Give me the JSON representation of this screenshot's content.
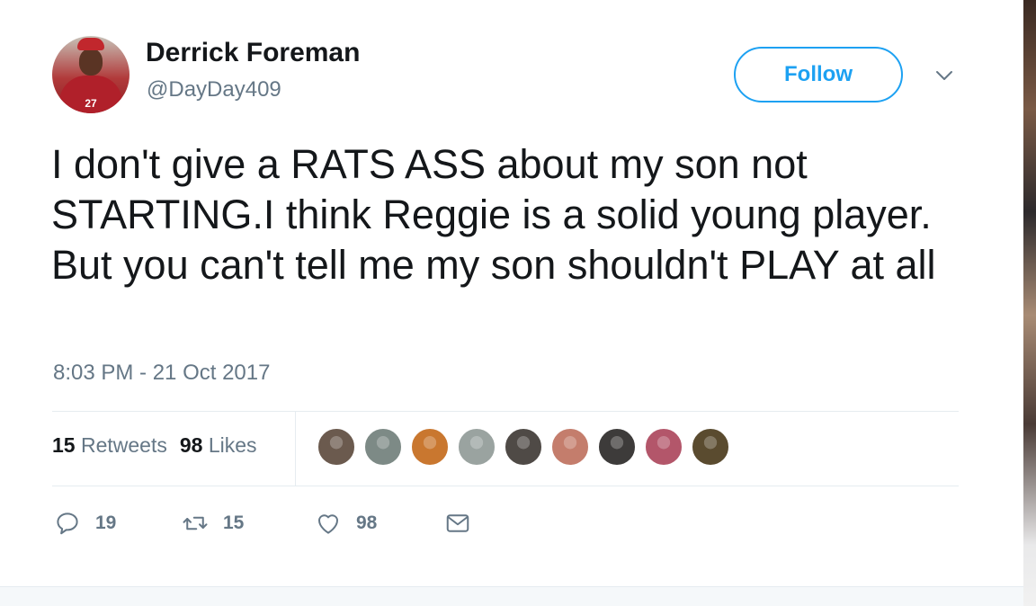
{
  "author": {
    "name": "Derrick Foreman",
    "handle": "@DayDay409",
    "avatar_jersey_number": "27"
  },
  "follow_button": {
    "label": "Follow"
  },
  "tweet": {
    "text": "I don't give a RATS ASS about my son not STARTING.I think Reggie is a solid young player. But you can't tell me my son shouldn't PLAY at all",
    "timestamp": "8:03 PM - 21 Oct 2017"
  },
  "stats": {
    "retweets_count": "15",
    "retweets_label": "Retweets",
    "likes_count": "98",
    "likes_label": "Likes"
  },
  "likers": [
    {
      "name": "liker-1",
      "color": "#6b5a4e"
    },
    {
      "name": "liker-2",
      "color": "#7d8a86"
    },
    {
      "name": "liker-3",
      "color": "#c9772f"
    },
    {
      "name": "liker-4",
      "color": "#9aa3a0"
    },
    {
      "name": "liker-5",
      "color": "#4f4a46"
    },
    {
      "name": "liker-6",
      "color": "#c47d6c"
    },
    {
      "name": "liker-7",
      "color": "#3d3b3a"
    },
    {
      "name": "liker-8",
      "color": "#b3566a"
    },
    {
      "name": "liker-9",
      "color": "#5a4b2f"
    }
  ],
  "actions": {
    "reply_count": "19",
    "retweet_count": "15",
    "like_count": "98"
  },
  "colors": {
    "accent": "#1da1f2",
    "secondary_text": "#657786",
    "primary_text": "#14171a",
    "divider": "#e6ecf0"
  }
}
